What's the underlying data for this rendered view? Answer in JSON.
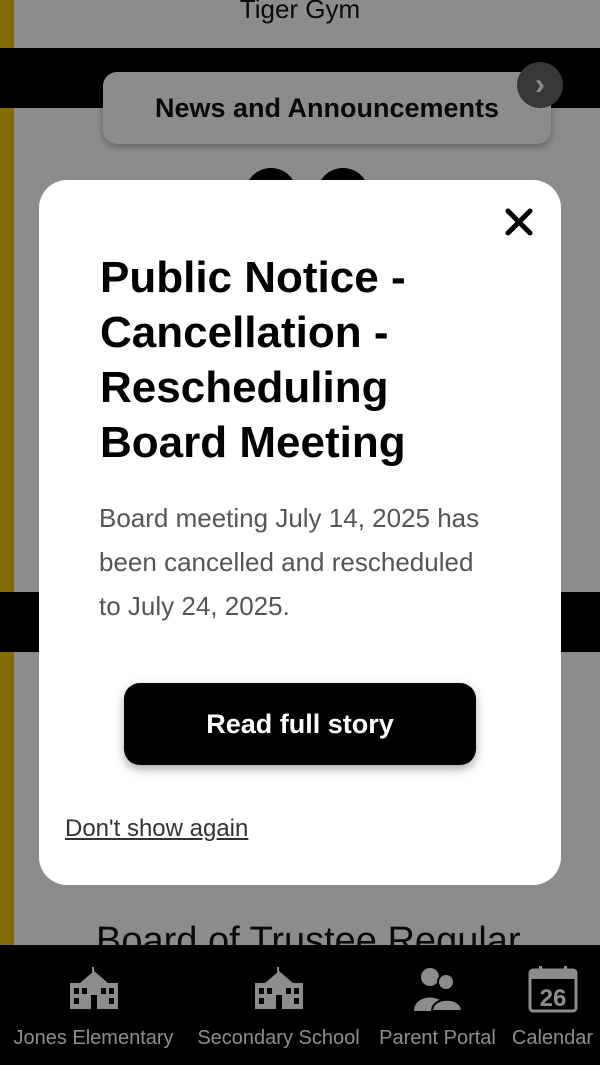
{
  "background": {
    "top_text": "Tiger Gym",
    "news_tab": "News and Announcements",
    "bottom_text": "Board of Trustee Regular"
  },
  "modal": {
    "title": "Public Notice - Cancellation - Rescheduling Board Meeting",
    "body": "Board meeting July 14, 2025 has been cancelled and rescheduled to July 24, 2025.",
    "read_button": "Read full story",
    "dont_show": "Don't show again",
    "close_icon": "close-icon"
  },
  "bottom_nav": {
    "items": [
      {
        "label": "Jones Elementary",
        "icon": "school-icon"
      },
      {
        "label": "Secondary School",
        "icon": "school-icon"
      },
      {
        "label": "Parent Portal",
        "icon": "parents-icon"
      },
      {
        "label": "Calendar",
        "icon": "calendar-icon",
        "day": "26"
      }
    ]
  },
  "colors": {
    "accent": "#f1c40f",
    "band": "#000000",
    "overlay": "rgba(0,0,0,0.45)"
  }
}
